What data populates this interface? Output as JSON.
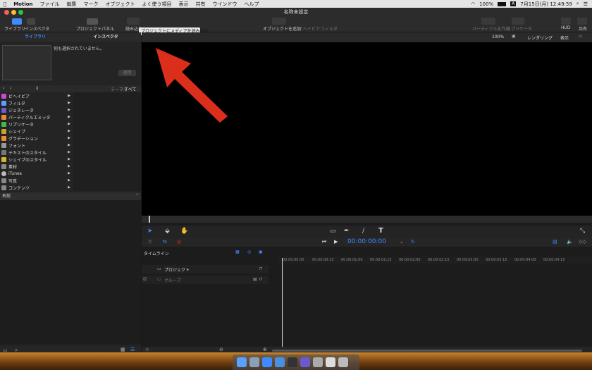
{
  "menubar": {
    "apple_icon": "apple-icon",
    "items": [
      "Motion",
      "ファイル",
      "編集",
      "マーク",
      "オブジェクト",
      "よく使う項目",
      "表示",
      "共有",
      "ウインドウ",
      "ヘルプ"
    ],
    "battery": "100%",
    "input_indicator": "A",
    "clock": "7月15日(月) 12:49:59"
  },
  "window": {
    "title": "名称未設定"
  },
  "toolbar": {
    "library_label": "ライブラリ",
    "inspector_label": "インスペクタ",
    "project_panel_label": "プロジェクトパネル",
    "import_label": "読み込む",
    "tooltip": "プロジェクトにメディアを読み込む",
    "add_object_label": "オブジェクトを追加",
    "behavior_label": "ビヘイビア",
    "filter_label": "フィルタ",
    "particles_label": "パーティクルを作成",
    "replicator_label": "リプリケータ",
    "hud_label": "HUD",
    "share_label": "共有"
  },
  "left_panel": {
    "tab_library": "ライブラリ",
    "tab_inspector": "インスペクタ",
    "no_selection": "何も選択されていません。",
    "apply_button": "適用",
    "theme_label": "テーマ:",
    "theme_value": "すべて",
    "items": [
      {
        "label": "ビヘイビア",
        "color": "#c84bd0"
      },
      {
        "label": "フィルタ",
        "color": "#5aa0ff"
      },
      {
        "label": "ジェネレータ",
        "color": "#6b5bd6"
      },
      {
        "label": "パーティクルエミッタ",
        "color": "#e68a2e"
      },
      {
        "label": "リプリケータ",
        "color": "#3dbb4a"
      },
      {
        "label": "シェイプ",
        "color": "#c9a227"
      },
      {
        "label": "グラデーション",
        "color": "#f28c28"
      },
      {
        "label": "フォント",
        "color": "#999999"
      },
      {
        "label": "テキストのスタイル",
        "color": "#777777"
      },
      {
        "label": "シェイプのスタイル",
        "color": "#d8b42b"
      },
      {
        "label": "素材",
        "color": "#888888"
      },
      {
        "label": "iTunes",
        "color": "#bbbbbb"
      },
      {
        "label": "写真",
        "color": "#888888"
      },
      {
        "label": "コンテンツ",
        "color": "#888888"
      }
    ],
    "name_header": "名前"
  },
  "viewer": {
    "zoom": "100%",
    "render_label": "レンダリング",
    "view_label": "表示",
    "timecode": "00:00:00:00"
  },
  "timeline": {
    "title": "タイムライン",
    "project_row": "プロジェクト",
    "group_row": "グループ",
    "ruler": [
      "00:00:00:00",
      "00:00:00:15",
      "00:00:01:00",
      "00:00:01:15",
      "00:00:02:00",
      "00:00:02:15",
      "00:00:03:00",
      "00:00:03:15",
      "00:00:04:00",
      "00:00:04:15"
    ]
  },
  "colors": {
    "accent": "#3d8bff",
    "annotation": "#e8321c",
    "canvas": "#000000",
    "panel": "#242424"
  }
}
